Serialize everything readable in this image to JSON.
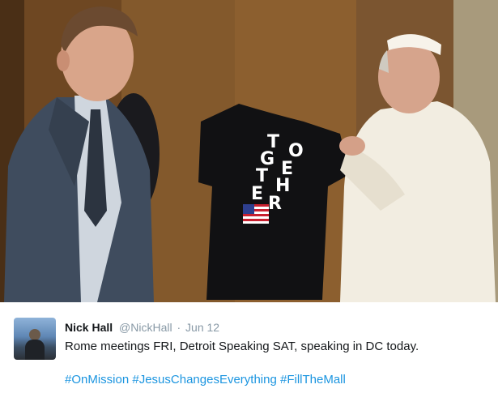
{
  "photo": {
    "shirt_text": [
      "T",
      "O",
      "G",
      "E",
      "T",
      "H",
      "E",
      "R"
    ]
  },
  "tweet": {
    "author_name": "Nick Hall",
    "author_handle": "@NickHall",
    "separator": "·",
    "date": "Jun 12",
    "text": "Rome meetings FRI, Detroit Speaking SAT, speaking in DC today.",
    "hashtags": [
      "#OnMission",
      "#JesusChangesEverything",
      "#FillTheMall"
    ]
  },
  "colors": {
    "name": "#14171a",
    "meta": "#8899a6",
    "link": "#1b95e0"
  }
}
